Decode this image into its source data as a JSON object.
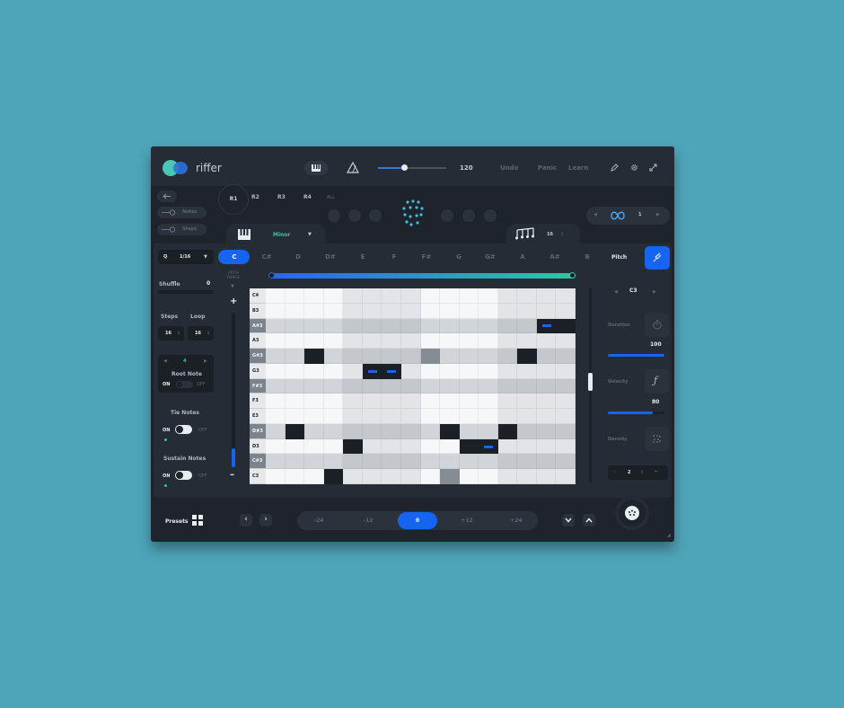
{
  "app": {
    "brand": "riffer"
  },
  "topbar": {
    "tempo": "120",
    "tempo_fraction": 0.38,
    "undo": "Undo",
    "panic": "Panic",
    "learn": "Learn"
  },
  "riffs": {
    "items": [
      "R1",
      "R2",
      "R3",
      "R4"
    ],
    "all": "ALL"
  },
  "left_tabs": {
    "notes": "Notes",
    "steps": "Steps"
  },
  "scale": {
    "value": "Minor"
  },
  "steps_control": {
    "value": "16"
  },
  "loop_control": {
    "value": "1"
  },
  "root_keys": {
    "items": [
      "C",
      "C#",
      "D",
      "D#",
      "E",
      "F",
      "F#",
      "G",
      "G#",
      "A",
      "A#",
      "B"
    ],
    "selected": "C"
  },
  "pitch_tab": "Pitch",
  "left_panel": {
    "quantize_q": "Q",
    "quantize": "1/16",
    "shuffle_label": "Shuffle",
    "shuffle_value": "0",
    "steps_label": "Steps",
    "loop_label": "Loop",
    "steps_value": "16",
    "loop_value": "16",
    "root_value": "4",
    "root_note_label": "Root Note",
    "root_on": "ON",
    "root_off": "OFF",
    "tie_notes_label": "Tie Notes",
    "tie_on": "ON",
    "tie_off": "OFF",
    "sustain_notes_label": "Sustain Notes",
    "sustain_on": "ON",
    "sustain_off": "OFF"
  },
  "pitch_range": {
    "label": "PITCH RANGE",
    "plus": "+",
    "minus": "–",
    "fraction": 0.12
  },
  "grid": {
    "rows": [
      "C4",
      "B3",
      "A#3",
      "A3",
      "G#3",
      "G3",
      "F#3",
      "F3",
      "E3",
      "D#3",
      "D3",
      "C#3",
      "C3"
    ],
    "black_rows": [
      "A#3",
      "G#3",
      "F#3",
      "D#3",
      "C#3"
    ],
    "columns": 16,
    "notes": [
      {
        "row": "A#3",
        "col": 14,
        "lead": true
      },
      {
        "row": "A#3",
        "col": 15,
        "lead": false
      },
      {
        "row": "G#3",
        "col": 2,
        "lead": false
      },
      {
        "row": "G#3",
        "col": 13,
        "lead": false
      },
      {
        "row": "G3",
        "col": 5,
        "lead": true
      },
      {
        "row": "G3",
        "col": 6,
        "lead": true
      },
      {
        "row": "D#3",
        "col": 1,
        "lead": false
      },
      {
        "row": "D#3",
        "col": 9,
        "lead": false
      },
      {
        "row": "D#3",
        "col": 12,
        "lead": false
      },
      {
        "row": "D3",
        "col": 4,
        "lead": false
      },
      {
        "row": "D3",
        "col": 11,
        "lead": true
      },
      {
        "row": "D3",
        "col": 10,
        "lead": false
      },
      {
        "row": "C3",
        "col": 3,
        "lead": false
      }
    ],
    "grey_cells": [
      {
        "row": "G#3",
        "col": 8
      },
      {
        "row": "C3",
        "col": 9
      }
    ]
  },
  "right_panel": {
    "note_value": "C3",
    "duration_label": "Duration",
    "duration_value": "100",
    "duration_fraction": 1.0,
    "velocity_label": "Velocity",
    "velocity_value": "80",
    "velocity_fraction": 0.8,
    "density_label": "Density",
    "density_value": "2"
  },
  "bottom": {
    "presets_label": "Presets",
    "octaves": [
      "-24",
      "-12",
      "0",
      "+12",
      "+24"
    ],
    "selected_octave": "0"
  },
  "colors": {
    "accent": "#1565f0",
    "teal": "#2ec7a2",
    "panel": "#262c35",
    "background": "#4ea4b9"
  }
}
